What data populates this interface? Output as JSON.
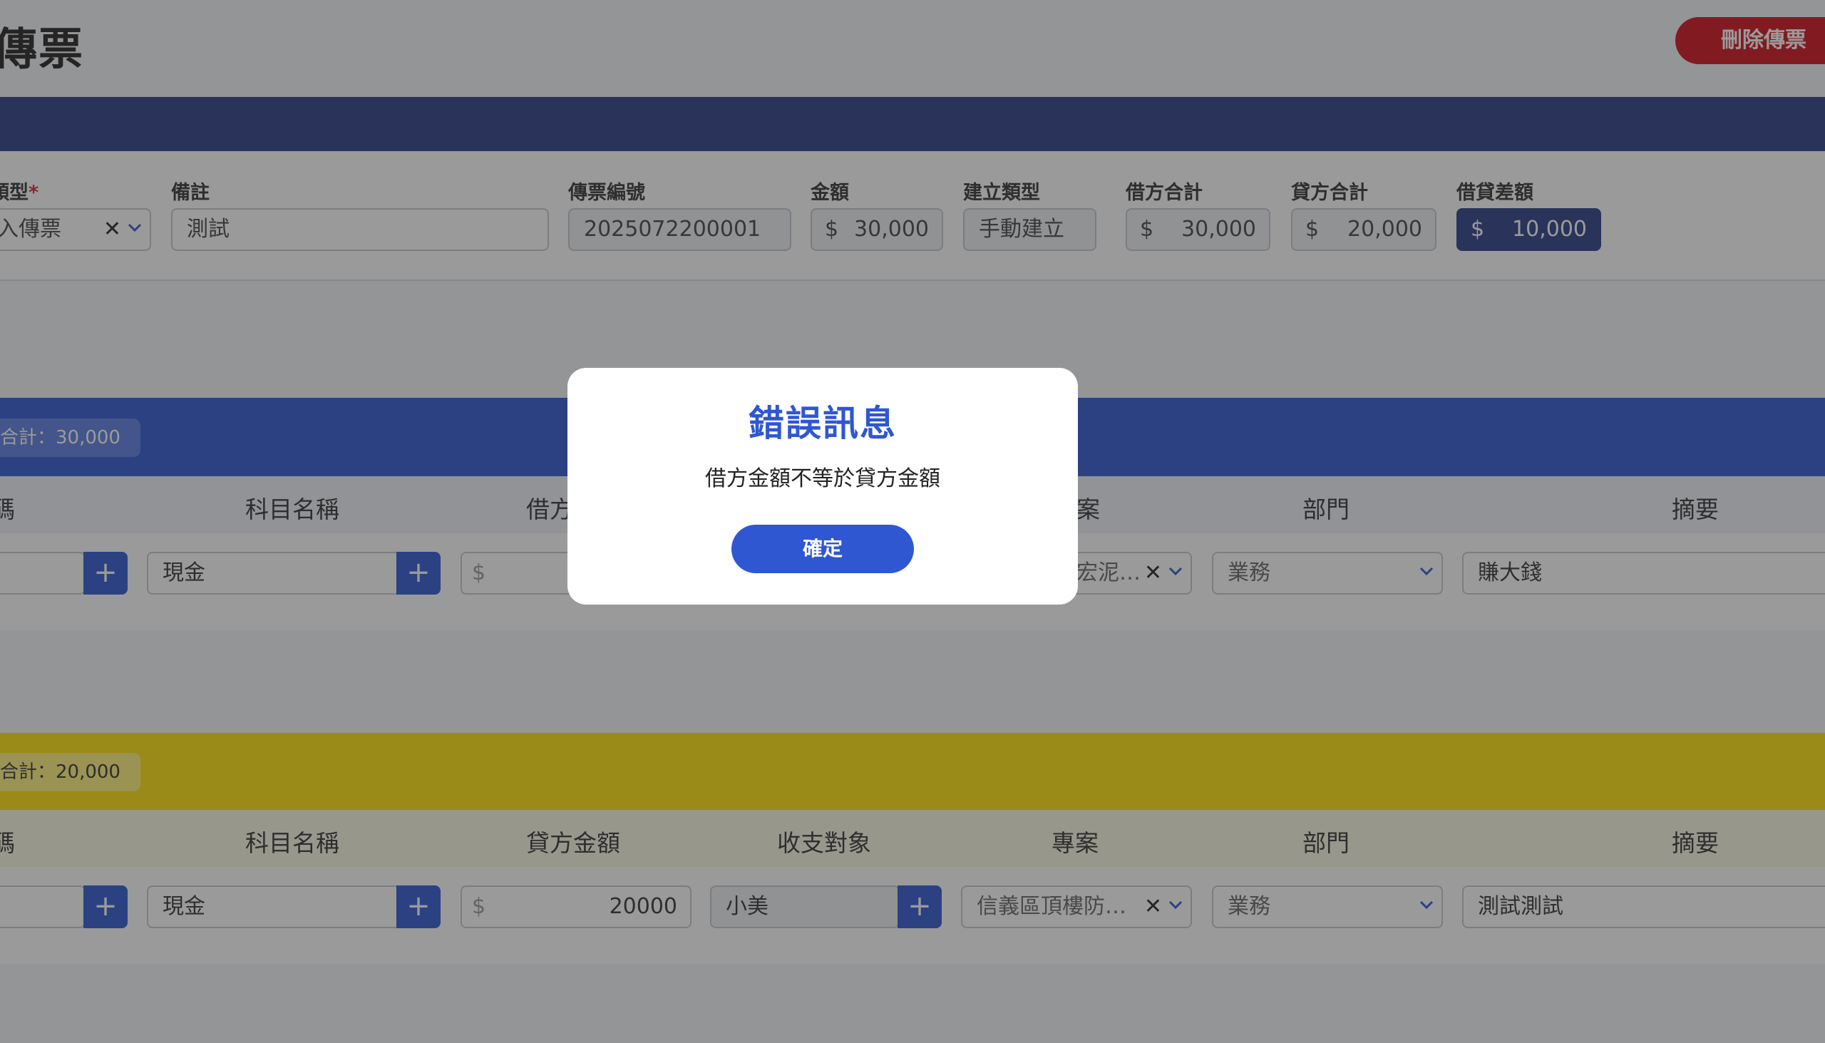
{
  "header": {
    "title": "傳票",
    "delete_label": "刪除傳票"
  },
  "form": {
    "type": {
      "label": "類型",
      "required_mark": "*",
      "value": "入傳票",
      "clear": "✕"
    },
    "note": {
      "label": "備註",
      "value": "測試"
    },
    "voucher_no": {
      "label": "傳票編號",
      "value": "2025072200001"
    },
    "amount": {
      "label": "金額",
      "currency": "$",
      "value": "30,000"
    },
    "create_type": {
      "label": "建立類型",
      "value": "手動建立"
    },
    "debit_total": {
      "label": "借方合計",
      "currency": "$",
      "value": "30,000"
    },
    "credit_total": {
      "label": "貸方合計",
      "currency": "$",
      "value": "20,000"
    },
    "difference": {
      "label": "借貸差額",
      "currency": "$",
      "value": "10,000"
    }
  },
  "debit": {
    "total_chip": "合計：30,000",
    "columns": [
      "碼",
      "科目名稱",
      "借方",
      "案",
      "部門",
      "摘要"
    ],
    "row": {
      "add": "+",
      "account_name": "現金",
      "amount_placeholder": "$",
      "project": "宏泥…",
      "project_clear": "✕",
      "department": "業務",
      "summary": "賺大錢"
    }
  },
  "credit": {
    "total_chip": "合計：20,000",
    "columns": [
      "碼",
      "科目名稱",
      "貸方金額",
      "收支對象",
      "專案",
      "部門",
      "摘要"
    ],
    "row": {
      "add": "+",
      "account_name": "現金",
      "amount_currency": "$",
      "amount": "20000",
      "counterparty": "小美",
      "project": "信義區頂樓防…",
      "project_clear": "✕",
      "department": "業務",
      "summary": "測試測試"
    }
  },
  "modal": {
    "title": "錯誤訊息",
    "message": "借方金額不等於貸方金額",
    "ok_label": "確定"
  },
  "colors": {
    "primary": "#2f57d2",
    "navy": "#2c3f86",
    "danger": "#d0101b",
    "credit_yellow": "#ffe20a"
  }
}
